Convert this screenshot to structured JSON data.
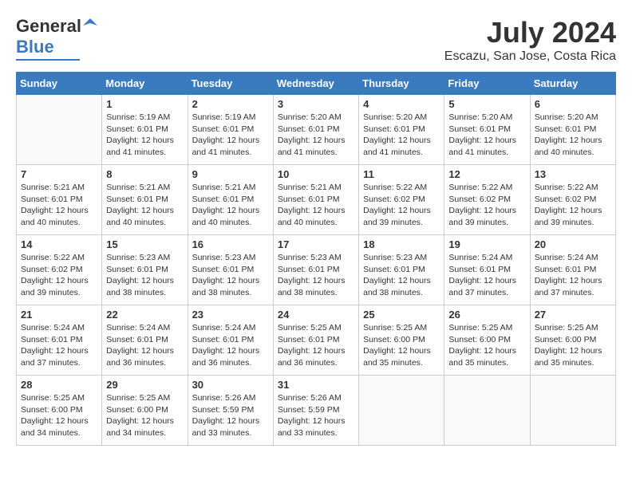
{
  "header": {
    "logo_general": "General",
    "logo_blue": "Blue",
    "month_year": "July 2024",
    "location": "Escazu, San Jose, Costa Rica"
  },
  "weekdays": [
    "Sunday",
    "Monday",
    "Tuesday",
    "Wednesday",
    "Thursday",
    "Friday",
    "Saturday"
  ],
  "weeks": [
    [
      {
        "day": "",
        "info": ""
      },
      {
        "day": "1",
        "info": "Sunrise: 5:19 AM\nSunset: 6:01 PM\nDaylight: 12 hours\nand 41 minutes."
      },
      {
        "day": "2",
        "info": "Sunrise: 5:19 AM\nSunset: 6:01 PM\nDaylight: 12 hours\nand 41 minutes."
      },
      {
        "day": "3",
        "info": "Sunrise: 5:20 AM\nSunset: 6:01 PM\nDaylight: 12 hours\nand 41 minutes."
      },
      {
        "day": "4",
        "info": "Sunrise: 5:20 AM\nSunset: 6:01 PM\nDaylight: 12 hours\nand 41 minutes."
      },
      {
        "day": "5",
        "info": "Sunrise: 5:20 AM\nSunset: 6:01 PM\nDaylight: 12 hours\nand 41 minutes."
      },
      {
        "day": "6",
        "info": "Sunrise: 5:20 AM\nSunset: 6:01 PM\nDaylight: 12 hours\nand 40 minutes."
      }
    ],
    [
      {
        "day": "7",
        "info": "Sunrise: 5:21 AM\nSunset: 6:01 PM\nDaylight: 12 hours\nand 40 minutes."
      },
      {
        "day": "8",
        "info": "Sunrise: 5:21 AM\nSunset: 6:01 PM\nDaylight: 12 hours\nand 40 minutes."
      },
      {
        "day": "9",
        "info": "Sunrise: 5:21 AM\nSunset: 6:01 PM\nDaylight: 12 hours\nand 40 minutes."
      },
      {
        "day": "10",
        "info": "Sunrise: 5:21 AM\nSunset: 6:01 PM\nDaylight: 12 hours\nand 40 minutes."
      },
      {
        "day": "11",
        "info": "Sunrise: 5:22 AM\nSunset: 6:02 PM\nDaylight: 12 hours\nand 39 minutes."
      },
      {
        "day": "12",
        "info": "Sunrise: 5:22 AM\nSunset: 6:02 PM\nDaylight: 12 hours\nand 39 minutes."
      },
      {
        "day": "13",
        "info": "Sunrise: 5:22 AM\nSunset: 6:02 PM\nDaylight: 12 hours\nand 39 minutes."
      }
    ],
    [
      {
        "day": "14",
        "info": "Sunrise: 5:22 AM\nSunset: 6:02 PM\nDaylight: 12 hours\nand 39 minutes."
      },
      {
        "day": "15",
        "info": "Sunrise: 5:23 AM\nSunset: 6:01 PM\nDaylight: 12 hours\nand 38 minutes."
      },
      {
        "day": "16",
        "info": "Sunrise: 5:23 AM\nSunset: 6:01 PM\nDaylight: 12 hours\nand 38 minutes."
      },
      {
        "day": "17",
        "info": "Sunrise: 5:23 AM\nSunset: 6:01 PM\nDaylight: 12 hours\nand 38 minutes."
      },
      {
        "day": "18",
        "info": "Sunrise: 5:23 AM\nSunset: 6:01 PM\nDaylight: 12 hours\nand 38 minutes."
      },
      {
        "day": "19",
        "info": "Sunrise: 5:24 AM\nSunset: 6:01 PM\nDaylight: 12 hours\nand 37 minutes."
      },
      {
        "day": "20",
        "info": "Sunrise: 5:24 AM\nSunset: 6:01 PM\nDaylight: 12 hours\nand 37 minutes."
      }
    ],
    [
      {
        "day": "21",
        "info": "Sunrise: 5:24 AM\nSunset: 6:01 PM\nDaylight: 12 hours\nand 37 minutes."
      },
      {
        "day": "22",
        "info": "Sunrise: 5:24 AM\nSunset: 6:01 PM\nDaylight: 12 hours\nand 36 minutes."
      },
      {
        "day": "23",
        "info": "Sunrise: 5:24 AM\nSunset: 6:01 PM\nDaylight: 12 hours\nand 36 minutes."
      },
      {
        "day": "24",
        "info": "Sunrise: 5:25 AM\nSunset: 6:01 PM\nDaylight: 12 hours\nand 36 minutes."
      },
      {
        "day": "25",
        "info": "Sunrise: 5:25 AM\nSunset: 6:00 PM\nDaylight: 12 hours\nand 35 minutes."
      },
      {
        "day": "26",
        "info": "Sunrise: 5:25 AM\nSunset: 6:00 PM\nDaylight: 12 hours\nand 35 minutes."
      },
      {
        "day": "27",
        "info": "Sunrise: 5:25 AM\nSunset: 6:00 PM\nDaylight: 12 hours\nand 35 minutes."
      }
    ],
    [
      {
        "day": "28",
        "info": "Sunrise: 5:25 AM\nSunset: 6:00 PM\nDaylight: 12 hours\nand 34 minutes."
      },
      {
        "day": "29",
        "info": "Sunrise: 5:25 AM\nSunset: 6:00 PM\nDaylight: 12 hours\nand 34 minutes."
      },
      {
        "day": "30",
        "info": "Sunrise: 5:26 AM\nSunset: 5:59 PM\nDaylight: 12 hours\nand 33 minutes."
      },
      {
        "day": "31",
        "info": "Sunrise: 5:26 AM\nSunset: 5:59 PM\nDaylight: 12 hours\nand 33 minutes."
      },
      {
        "day": "",
        "info": ""
      },
      {
        "day": "",
        "info": ""
      },
      {
        "day": "",
        "info": ""
      }
    ]
  ]
}
